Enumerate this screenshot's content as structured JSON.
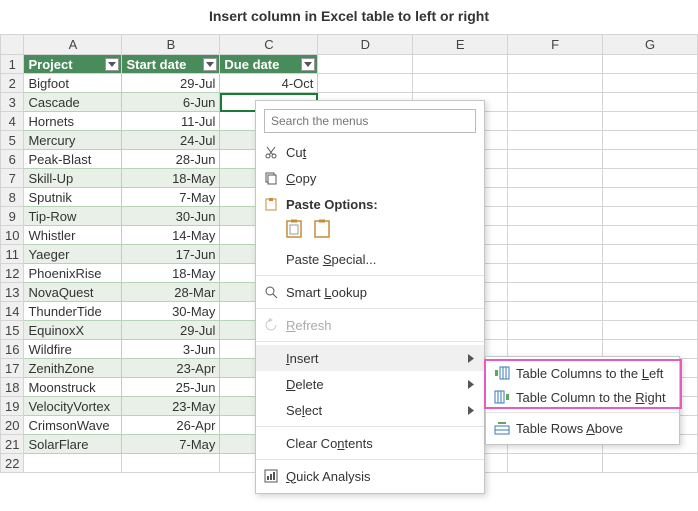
{
  "title": "Insert column in Excel table to left or right",
  "columns": [
    "A",
    "B",
    "C",
    "D",
    "E",
    "F",
    "G"
  ],
  "headers": {
    "A": "Project",
    "B": "Start date",
    "C": "Due date"
  },
  "rows": [
    {
      "n": 2,
      "A": "Bigfoot",
      "B": "29-Jul",
      "C": "4-Oct"
    },
    {
      "n": 3,
      "A": "Cascade",
      "B": "6-Jun",
      "C": ""
    },
    {
      "n": 4,
      "A": "Hornets",
      "B": "11-Jul",
      "C": ""
    },
    {
      "n": 5,
      "A": "Mercury",
      "B": "24-Jul",
      "C": ""
    },
    {
      "n": 6,
      "A": "Peak-Blast",
      "B": "28-Jun",
      "C": ""
    },
    {
      "n": 7,
      "A": "Skill-Up",
      "B": "18-May",
      "C": ""
    },
    {
      "n": 8,
      "A": "Sputnik",
      "B": "7-May",
      "C": ""
    },
    {
      "n": 9,
      "A": "Tip-Row",
      "B": "30-Jun",
      "C": ""
    },
    {
      "n": 10,
      "A": "Whistler",
      "B": "14-May",
      "C": ""
    },
    {
      "n": 11,
      "A": "Yaeger",
      "B": "17-Jun",
      "C": ""
    },
    {
      "n": 12,
      "A": "PhoenixRise",
      "B": "18-May",
      "C": ""
    },
    {
      "n": 13,
      "A": "NovaQuest",
      "B": "28-Mar",
      "C": ""
    },
    {
      "n": 14,
      "A": "ThunderTide",
      "B": "30-May",
      "C": ""
    },
    {
      "n": 15,
      "A": "EquinoxX",
      "B": "29-Jul",
      "C": ""
    },
    {
      "n": 16,
      "A": "Wildfire",
      "B": "3-Jun",
      "C": ""
    },
    {
      "n": 17,
      "A": "ZenithZone",
      "B": "23-Apr",
      "C": ""
    },
    {
      "n": 18,
      "A": "Moonstruck",
      "B": "25-Jun",
      "C": ""
    },
    {
      "n": 19,
      "A": "VelocityVortex",
      "B": "23-May",
      "C": ""
    },
    {
      "n": 20,
      "A": "CrimsonWave",
      "B": "26-Apr",
      "C": ""
    },
    {
      "n": 21,
      "A": "SolarFlare",
      "B": "7-May",
      "C": ""
    }
  ],
  "selected_cell": "C3",
  "menu": {
    "search_placeholder": "Search the menus",
    "cut": "Cut",
    "copy": "Copy",
    "paste_options": "Paste Options:",
    "paste_special": "Paste Special...",
    "smart_lookup": "Smart Lookup",
    "refresh": "Refresh",
    "insert": "Insert",
    "delete": "Delete",
    "select": "Select",
    "clear_contents": "Clear Contents",
    "quick_analysis": "Quick Analysis"
  },
  "submenu": {
    "cols_left": "Table Columns to the Left",
    "cols_right": "Table Column to the Right",
    "rows_above": "Table Rows Above"
  }
}
